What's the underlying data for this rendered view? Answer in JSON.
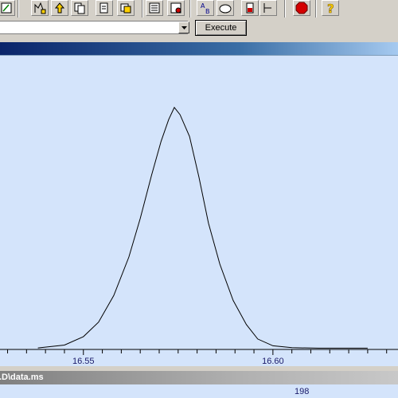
{
  "toolbar": {
    "icons": [
      "edit-chart-icon",
      "tune-chart-icon",
      "upload-icon",
      "copy-icon",
      "paste-icon",
      "print-icon",
      "calc-icon",
      "ab-compare-icon",
      "hand-icon",
      "battery-icon",
      "select-icon",
      "stop-icon",
      "help-icon"
    ]
  },
  "command": {
    "value": "",
    "execute_label": "Execute"
  },
  "chart_data": {
    "type": "line",
    "xlim": [
      16.528,
      16.633
    ],
    "x_ticks": [
      16.55,
      16.6
    ],
    "x_tick_labels": [
      "16.55",
      "16.60"
    ],
    "series": [
      {
        "x": [
          16.538,
          16.545,
          16.55,
          16.554,
          16.558,
          16.562,
          16.565,
          16.568,
          16.5705,
          16.5725,
          16.574,
          16.5755,
          16.578,
          16.5805,
          16.583,
          16.586,
          16.5895,
          16.593,
          16.596,
          16.6,
          16.605,
          16.612,
          16.62,
          16.625
        ],
        "y": [
          0.003,
          0.015,
          0.05,
          0.11,
          0.22,
          0.38,
          0.54,
          0.72,
          0.86,
          0.95,
          1.0,
          0.97,
          0.88,
          0.71,
          0.52,
          0.35,
          0.2,
          0.1,
          0.04,
          0.012,
          0.004,
          0.002,
          0.002,
          0.002
        ]
      }
    ],
    "line_color": "#000000",
    "background": "#d4e4fb"
  },
  "bottom_window": {
    "title": ".D\\data.ms",
    "tick_label": "198"
  }
}
